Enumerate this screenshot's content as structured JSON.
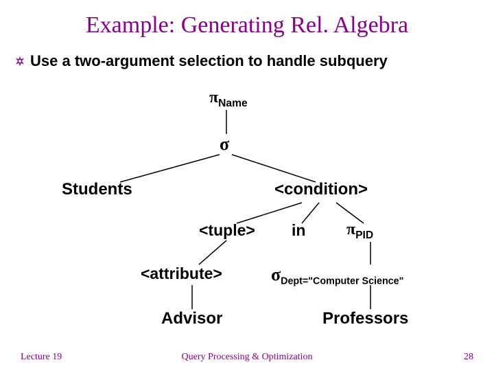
{
  "title": "Example: Generating Rel. Algebra",
  "bullet": "Use a two-argument selection to handle subquery",
  "nodes": {
    "pi_name": {
      "sym": "π",
      "sub": "Name"
    },
    "sigma": "σ",
    "students": "Students",
    "condition": "<condition>",
    "tuple": "<tuple>",
    "in": "in",
    "pi_pid": {
      "sym": "π",
      "sub": "PID"
    },
    "attribute": "<attribute>",
    "sigma_dept": {
      "sym": "σ",
      "sub": "Dept=\"Computer Science\""
    },
    "advisor": "Advisor",
    "professors": "Professors"
  },
  "footer": {
    "left": "Lecture 19",
    "center": "Query Processing & Optimization",
    "right": "28"
  }
}
